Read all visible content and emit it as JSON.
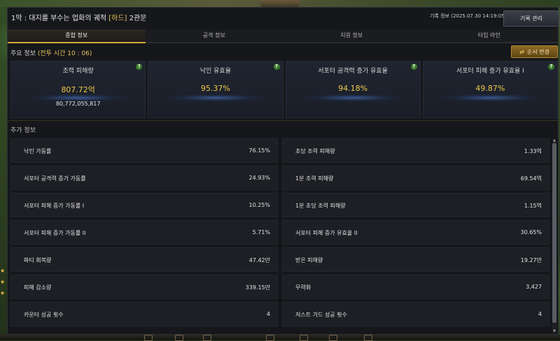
{
  "window": {
    "title_prefix": "1막 : 대지를 부수는 업화의 궤적",
    "difficulty": "[하드]",
    "gate": "2관문",
    "record_info": "기록 정보 (2025.07.30 14:19:05)",
    "record_button": "기록 관리"
  },
  "tabs": [
    {
      "label": "종합 정보",
      "active": true
    },
    {
      "label": "공격 정보",
      "active": false
    },
    {
      "label": "지원 정보",
      "active": false
    },
    {
      "label": "타임 라인",
      "active": false
    }
  ],
  "main": {
    "label": "주요 정보",
    "battle_time": "(전투 시간 10 : 06)",
    "sort_button": "순서 변경",
    "help_glyph": "?",
    "cards": [
      {
        "label": "조력 피해량",
        "value": "807.72억",
        "sub": "80,772,055,817"
      },
      {
        "label": "낙인 유효율",
        "value": "95.37%",
        "sub": ""
      },
      {
        "label": "서포터 공격력 증가 유효율",
        "value": "94.18%",
        "sub": ""
      },
      {
        "label": "서포터 피해 증가 유효율 I",
        "value": "49.87%",
        "sub": ""
      }
    ]
  },
  "extra": {
    "label": "추가 정보",
    "left": [
      {
        "key": "낙인 가동률",
        "value": "76.15%"
      },
      {
        "key": "서포터 공격력 증가 가동률",
        "value": "24.93%"
      },
      {
        "key": "서포터 피해 증가 가동률 I",
        "value": "10.25%"
      },
      {
        "key": "서포터 피해 증가 가동률 II",
        "value": "5.71%"
      },
      {
        "key": "파티 회복량",
        "value": "47.42만"
      },
      {
        "key": "피해 감소량",
        "value": "339.15만"
      },
      {
        "key": "카운터 성공 횟수",
        "value": "4"
      }
    ],
    "right": [
      {
        "key": "초당 조력 피해량",
        "value": "1.33억"
      },
      {
        "key": "1분 조력 피해량",
        "value": "69.54억"
      },
      {
        "key": "1분 초당 조력 피해량",
        "value": "1.15억"
      },
      {
        "key": "서포터 피해 증가 유효율 II",
        "value": "30.65%"
      },
      {
        "key": "받은 피해량",
        "value": "19.27만"
      },
      {
        "key": "무력화",
        "value": "3,427"
      },
      {
        "key": "저스트 가드 성공 횟수",
        "value": "4"
      }
    ]
  },
  "colors": {
    "accent": "#d4a83c",
    "value_gold": "#f0c84a",
    "panel": "#16171b"
  }
}
